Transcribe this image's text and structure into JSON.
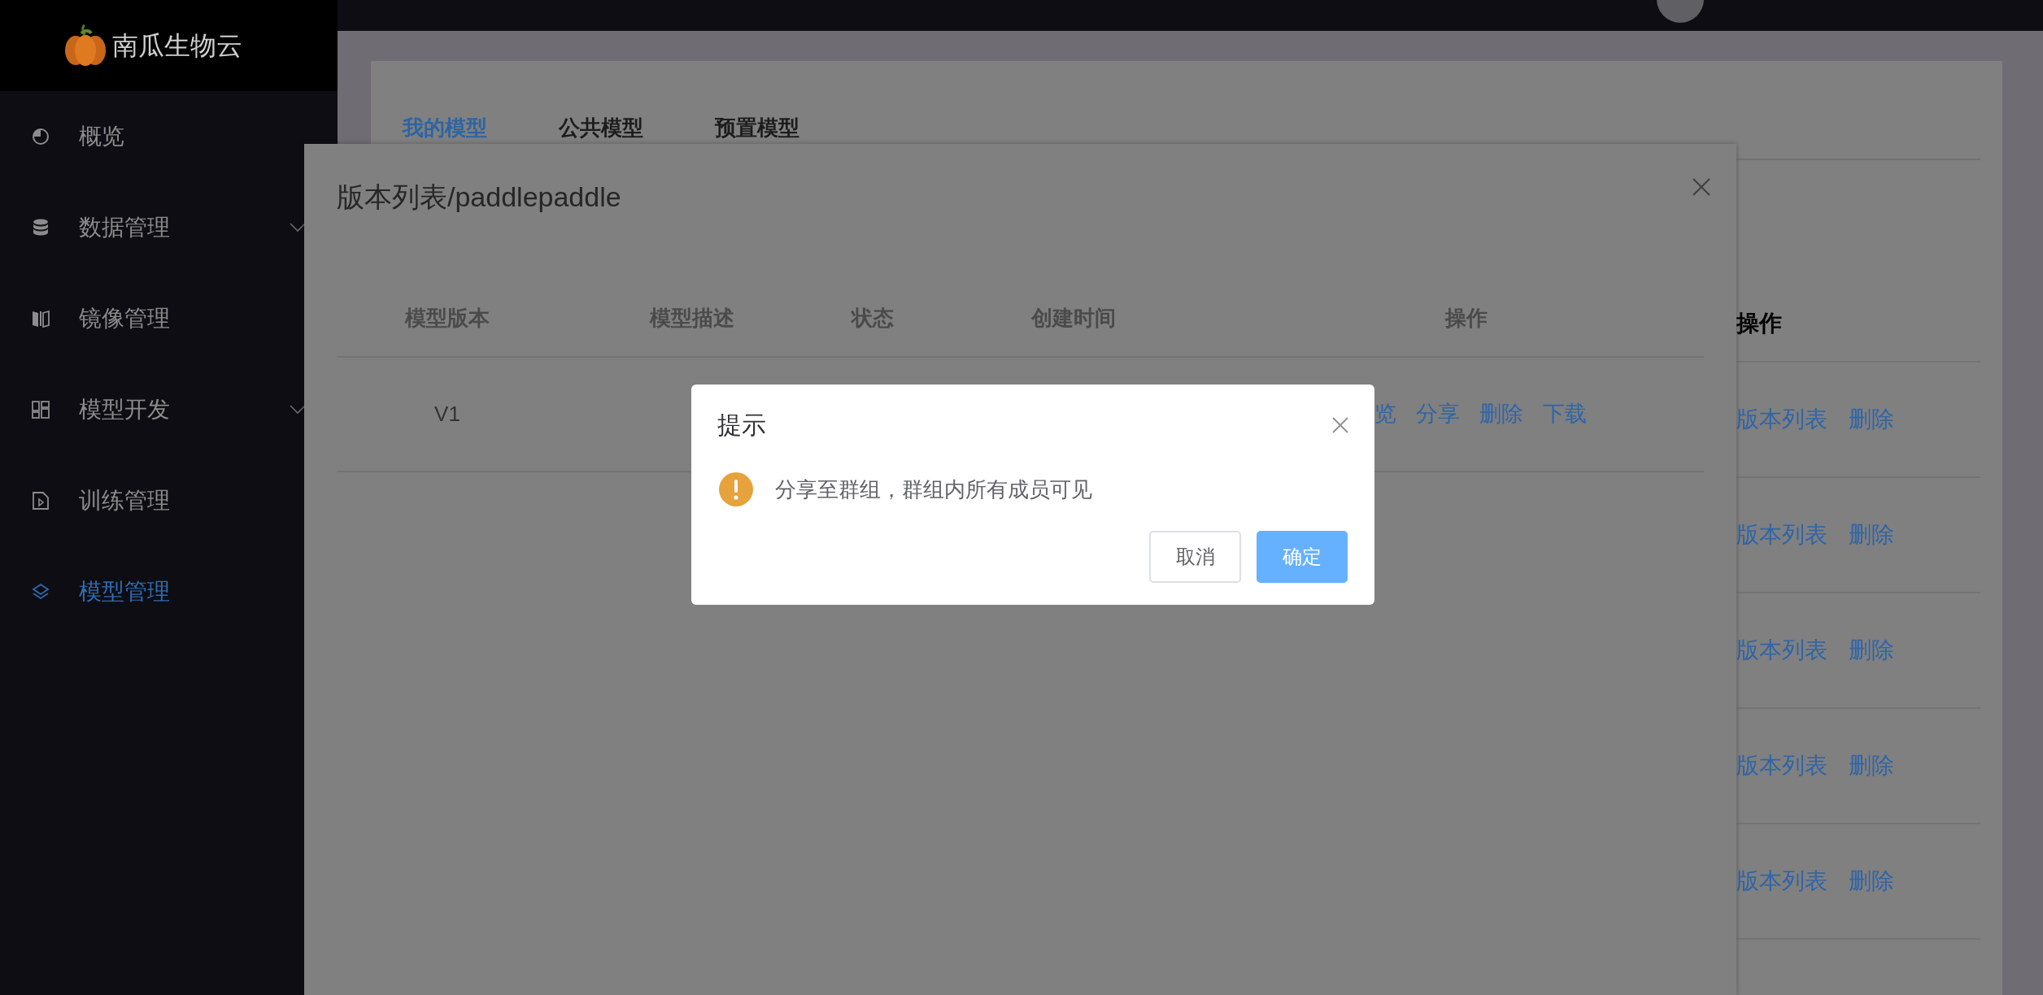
{
  "sidebar": {
    "logo": "南瓜生物云",
    "items": [
      {
        "label": "概览",
        "expandable": false,
        "selected": false
      },
      {
        "label": "数据管理",
        "expandable": true,
        "selected": false
      },
      {
        "label": "镜像管理",
        "expandable": false,
        "selected": false
      },
      {
        "label": "模型开发",
        "expandable": true,
        "selected": false
      },
      {
        "label": "训练管理",
        "expandable": false,
        "selected": false
      },
      {
        "label": "模型管理",
        "expandable": false,
        "selected": true
      }
    ]
  },
  "page": {
    "tabs": [
      {
        "label": "我的模型",
        "selected": true
      },
      {
        "label": "公共模型",
        "selected": false
      },
      {
        "label": "预置模型",
        "selected": false
      }
    ],
    "table": {
      "columns": [
        "操作"
      ],
      "rows": [
        {
          "actions": [
            "版本列表",
            "删除"
          ]
        },
        {
          "actions": [
            "版本列表",
            "删除"
          ]
        },
        {
          "actions": [
            "版本列表",
            "删除"
          ]
        },
        {
          "actions": [
            "版本列表",
            "删除"
          ]
        },
        {
          "actions": [
            "版本列表",
            "删除"
          ]
        }
      ]
    }
  },
  "version_dialog": {
    "title": "版本列表/paddlepaddle",
    "columns": [
      "模型版本",
      "模型描述",
      "状态",
      "创建时间",
      "操作"
    ],
    "rows": [
      {
        "version": "V1",
        "actions": [
          "览",
          "分享",
          "删除",
          "下载"
        ]
      }
    ]
  },
  "confirm_dialog": {
    "title": "提示",
    "message": "分享至群组，群组内所有成员可见",
    "buttons": [
      {
        "label": "取消",
        "kind": "default"
      },
      {
        "label": "确定",
        "kind": "primary"
      }
    ]
  }
}
